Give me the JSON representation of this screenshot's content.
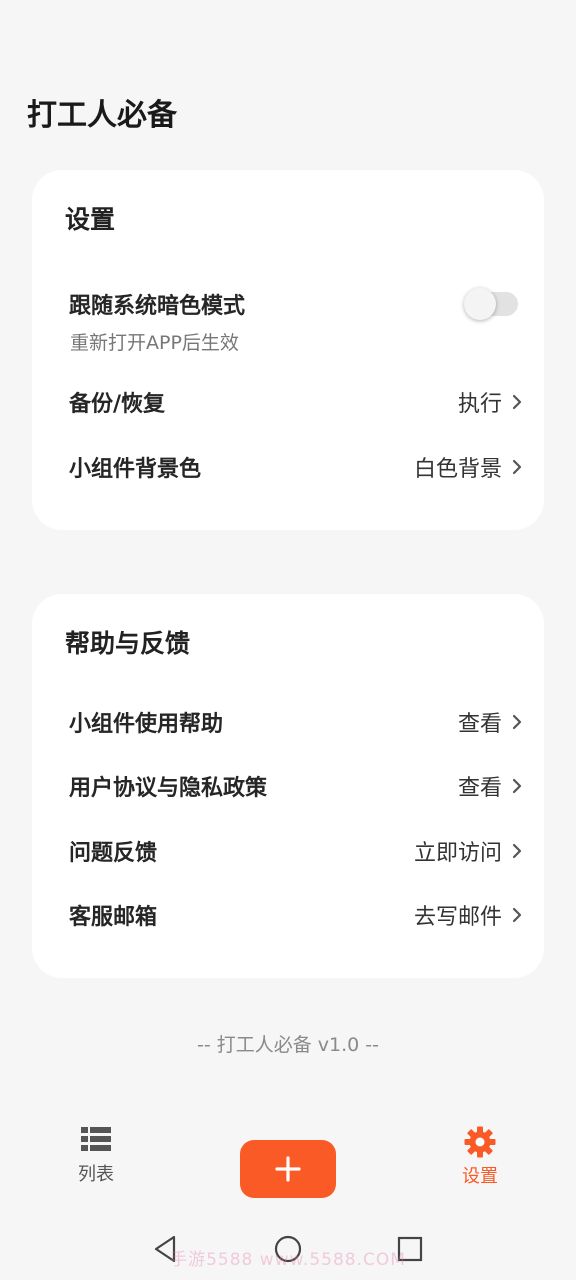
{
  "app": {
    "title": "打工人必备"
  },
  "settings": {
    "title": "设置",
    "dark_mode": {
      "label": "跟随系统暗色模式",
      "sublabel": "重新打开APP后生效",
      "enabled": false
    },
    "backup": {
      "label": "备份/恢复",
      "value": "执行"
    },
    "widget_bg": {
      "label": "小组件背景色",
      "value": "白色背景"
    }
  },
  "help": {
    "title": "帮助与反馈",
    "items": [
      {
        "label": "小组件使用帮助",
        "value": "查看"
      },
      {
        "label": "用户协议与隐私政策",
        "value": "查看"
      },
      {
        "label": "问题反馈",
        "value": "立即访问"
      },
      {
        "label": "客服邮箱",
        "value": "去写邮件"
      }
    ]
  },
  "footer": {
    "version_text": "-- 打工人必备 v1.0 --"
  },
  "tabbar": {
    "list": {
      "label": "列表",
      "icon": "list-icon"
    },
    "add": {
      "icon": "plus-icon"
    },
    "settings": {
      "label": "设置",
      "icon": "gear-icon"
    }
  },
  "watermark": "手游5588  www.5588.COM",
  "colors": {
    "accent": "#fa5a25",
    "background": "#f6f6f6",
    "card": "#ffffff"
  }
}
